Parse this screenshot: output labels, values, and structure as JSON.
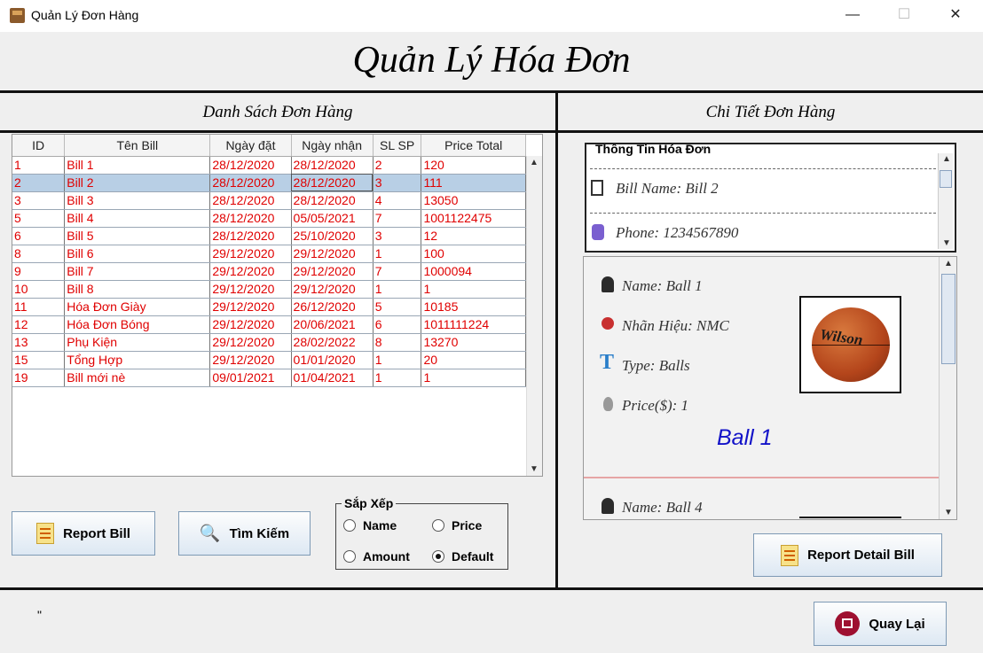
{
  "window": {
    "title": "Quản Lý Đơn Hàng",
    "minimize": "—",
    "maximize": "☐",
    "close": "✕"
  },
  "heading": "Quản Lý Hóa Đơn",
  "left_title": "Danh Sách Đơn Hàng",
  "right_title": "Chi Tiết Đơn Hàng",
  "table": {
    "columns": [
      "ID",
      "Tên Bill",
      "Ngày đặt",
      "Ngày nhận",
      "SL SP",
      "Price Total"
    ],
    "selected_index": 1,
    "rows": [
      [
        "1",
        "Bill 1",
        "28/12/2020",
        "28/12/2020",
        "2",
        "120"
      ],
      [
        "2",
        "Bill 2",
        "28/12/2020",
        "28/12/2020",
        "3",
        "111"
      ],
      [
        "3",
        "Bill 3",
        "28/12/2020",
        "28/12/2020",
        "4",
        "13050"
      ],
      [
        "5",
        "Bill 4",
        "28/12/2020",
        "05/05/2021",
        "7",
        "1001122475"
      ],
      [
        "6",
        "Bill 5",
        "28/12/2020",
        "25/10/2020",
        "3",
        "12"
      ],
      [
        "8",
        "Bill 6",
        "29/12/2020",
        "29/12/2020",
        "1",
        "100"
      ],
      [
        "9",
        "Bill 7",
        "29/12/2020",
        "29/12/2020",
        "7",
        "1000094"
      ],
      [
        "10",
        "Bill 8",
        "29/12/2020",
        "29/12/2020",
        "1",
        "1"
      ],
      [
        "11",
        "Hóa Đơn Giày",
        "29/12/2020",
        "26/12/2020",
        "5",
        "10185"
      ],
      [
        "12",
        "Hóa Đơn Bóng",
        "29/12/2020",
        "20/06/2021",
        "6",
        "1011111224"
      ],
      [
        "13",
        " Phụ Kiện",
        "29/12/2020",
        "28/02/2022",
        "8",
        "13270"
      ],
      [
        "15",
        "Tổng Hợp",
        "29/12/2020",
        "01/01/2020",
        "1",
        "20"
      ],
      [
        "19",
        "Bill mới nè",
        "09/01/2021",
        "01/04/2021",
        "1",
        "1"
      ]
    ]
  },
  "buttons": {
    "report_bill": "Report Bill",
    "search": "Tìm Kiếm",
    "report_detail": "Report Detail Bill",
    "back": "Quay Lại"
  },
  "sort": {
    "legend": "Sắp Xếp",
    "name": "Name",
    "price": "Price",
    "amount": "Amount",
    "default": "Default",
    "selected": "Default"
  },
  "info": {
    "legend": "Thông Tin Hóa Đơn",
    "bill_name": "Bill Name: Bill 2",
    "phone": "Phone: 1234567890"
  },
  "detail": {
    "item1": {
      "name": "Name: Ball 1",
      "brand": "Nhãn Hiệu: NMC",
      "type": "Type: Balls",
      "price": "Price($): 1",
      "title": "Ball 1",
      "image_brand": "Wilson"
    },
    "item2": {
      "name": "Name: Ball 4"
    }
  },
  "status_mark": "\""
}
